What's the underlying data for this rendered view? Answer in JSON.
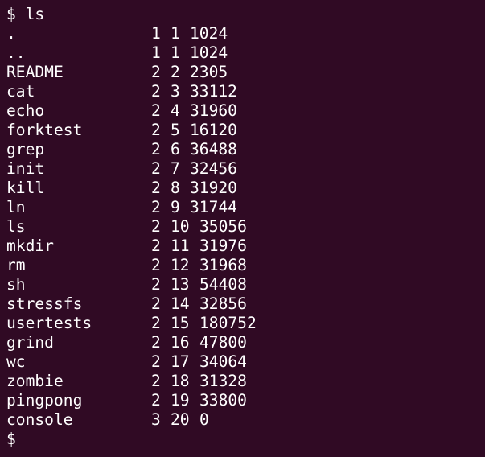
{
  "terminal": {
    "background": "#300a24",
    "foreground": "#ffffff",
    "top_fragment": "+",
    "prompt": "$",
    "command": "ls",
    "entries": [
      {
        "name": ".",
        "type": "1",
        "inode": "1",
        "size": "1024"
      },
      {
        "name": "..",
        "type": "1",
        "inode": "1",
        "size": "1024"
      },
      {
        "name": "README",
        "type": "2",
        "inode": "2",
        "size": "2305"
      },
      {
        "name": "cat",
        "type": "2",
        "inode": "3",
        "size": "33112"
      },
      {
        "name": "echo",
        "type": "2",
        "inode": "4",
        "size": "31960"
      },
      {
        "name": "forktest",
        "type": "2",
        "inode": "5",
        "size": "16120"
      },
      {
        "name": "grep",
        "type": "2",
        "inode": "6",
        "size": "36488"
      },
      {
        "name": "init",
        "type": "2",
        "inode": "7",
        "size": "32456"
      },
      {
        "name": "kill",
        "type": "2",
        "inode": "8",
        "size": "31920"
      },
      {
        "name": "ln",
        "type": "2",
        "inode": "9",
        "size": "31744"
      },
      {
        "name": "ls",
        "type": "2",
        "inode": "10",
        "size": "35056"
      },
      {
        "name": "mkdir",
        "type": "2",
        "inode": "11",
        "size": "31976"
      },
      {
        "name": "rm",
        "type": "2",
        "inode": "12",
        "size": "31968"
      },
      {
        "name": "sh",
        "type": "2",
        "inode": "13",
        "size": "54408"
      },
      {
        "name": "stressfs",
        "type": "2",
        "inode": "14",
        "size": "32856"
      },
      {
        "name": "usertests",
        "type": "2",
        "inode": "15",
        "size": "180752"
      },
      {
        "name": "grind",
        "type": "2",
        "inode": "16",
        "size": "47800"
      },
      {
        "name": "wc",
        "type": "2",
        "inode": "17",
        "size": "34064"
      },
      {
        "name": "zombie",
        "type": "2",
        "inode": "18",
        "size": "31328"
      },
      {
        "name": "pingpong",
        "type": "2",
        "inode": "19",
        "size": "33800"
      },
      {
        "name": "console",
        "type": "3",
        "inode": "20",
        "size": "0"
      }
    ],
    "final_prompt": "$"
  }
}
